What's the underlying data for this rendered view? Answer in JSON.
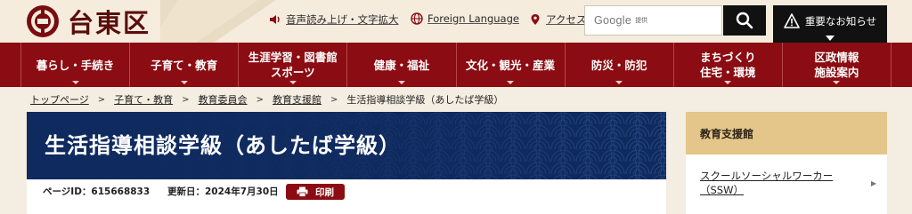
{
  "header": {
    "logo_text": "台東区",
    "links": {
      "voice": "音声読み上げ・文字拡大",
      "language": "Foreign Language",
      "access": "アクセス"
    },
    "search": {
      "brand": "Google",
      "provided": "提供"
    },
    "notice_label": "重要なお知らせ"
  },
  "nav": {
    "items": [
      "暮らし・手続き",
      "子育て・教育",
      "生涯学習・図書館\nスポーツ",
      "健康・福祉",
      "文化・観光・産業",
      "防災・防犯",
      "まちづくり\n住宅・環境",
      "区政情報\n施設案内"
    ]
  },
  "breadcrumb": {
    "items": [
      "トップページ",
      "子育て・教育",
      "教育委員会",
      "教育支援館"
    ],
    "current": "生活指導相談学級（あしたば学級）"
  },
  "main": {
    "title": "生活指導相談学級（あしたば学級）",
    "page_id": "ページID：615668833",
    "updated": "更新日：2024年7月30日",
    "print_label": "印刷"
  },
  "sidebar": {
    "heading": "教育支援館",
    "items": [
      "スクールソーシャルワーカー（SSW）"
    ]
  },
  "colors": {
    "nav_red": "#8b0c12",
    "banner_navy": "#0f2a5e",
    "sidebar_gold": "#e4c58a",
    "header_cream": "#f5ecdd"
  }
}
